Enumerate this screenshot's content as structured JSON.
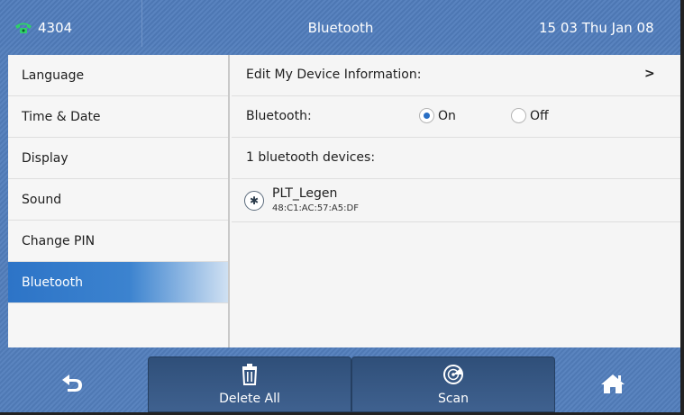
{
  "titlebar": {
    "line_icon": "phone-handset-icon",
    "line_number": "4304",
    "title": "Bluetooth",
    "clock": "15 03 Thu Jan 08"
  },
  "sidebar": {
    "items": [
      {
        "label": "Language"
      },
      {
        "label": "Time & Date"
      },
      {
        "label": "Display"
      },
      {
        "label": "Sound"
      },
      {
        "label": "Change PIN"
      },
      {
        "label": "Bluetooth",
        "selected": true
      }
    ]
  },
  "main": {
    "edit_device": {
      "label": "Edit My Device Information:",
      "chevron_icon": "chevron-right-icon"
    },
    "bluetooth": {
      "label": "Bluetooth:",
      "on_label": "On",
      "off_label": "Off",
      "selected": "On"
    },
    "devices_count_label": "1 bluetooth devices:",
    "devices": [
      {
        "icon": "bluetooth-icon",
        "name": "PLT_Legen",
        "mac": "48:C1:AC:57:A5:DF"
      }
    ]
  },
  "softkeys": {
    "back_icon": "back-arrow-icon",
    "delete_all_label": "Delete All",
    "delete_icon": "trash-icon",
    "scan_label": "Scan",
    "scan_icon": "radar-icon",
    "home_icon": "home-icon"
  },
  "colors": {
    "accent": "#2d74c7",
    "titlebar_bg": "#5580bb",
    "line_icon": "#2fd16a"
  }
}
